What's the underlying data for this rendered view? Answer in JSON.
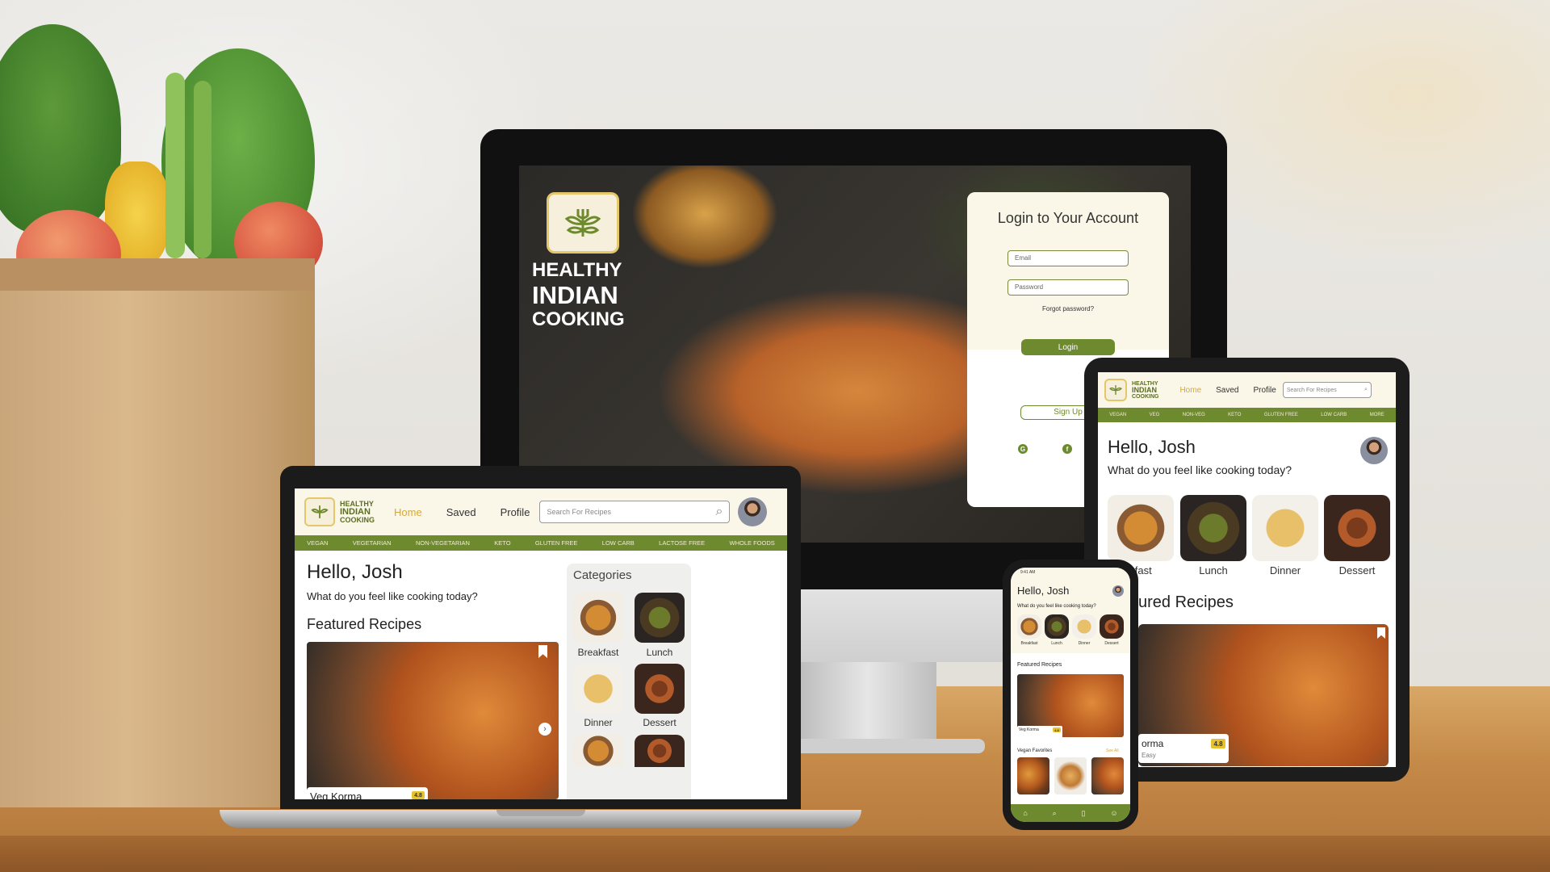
{
  "brand": {
    "line1": "HEALTHY",
    "line2": "INDIAN",
    "line3": "COOKING"
  },
  "login": {
    "title": "Login to Your Account",
    "email_placeholder": "Email",
    "password_placeholder": "Password",
    "forgot": "Forgot password?",
    "login_label": "Login",
    "no_account": "Don't have an a",
    "signup_label": "Sign Up",
    "continue": "Continue Without S",
    "social": [
      "google-icon",
      "facebook-icon"
    ]
  },
  "nav": {
    "home": "Home",
    "saved": "Saved",
    "profile": "Profile",
    "search_placeholder": "Search For Recipes"
  },
  "laptop": {
    "categories_bar": [
      "VEGAN",
      "VEGETARIAN",
      "NON-VEGETARIAN",
      "KETO",
      "GLUTEN FREE",
      "LOW CARB",
      "LACTOSE FREE",
      "WHOLE FOODS"
    ],
    "hello": "Hello, Josh",
    "question": "What do you feel like cooking today?",
    "featured_title": "Featured Recipes",
    "featured_recipe": {
      "name": "Veg Korma",
      "rating": "4.8"
    },
    "categories_title": "Categories",
    "categories": [
      "Breakfast",
      "Lunch",
      "Dinner",
      "Dessert"
    ]
  },
  "tablet": {
    "categories_bar": [
      "VEGAN",
      "VEG",
      "NON-VEG",
      "KETO",
      "GLUTEN FREE",
      "LOW CARB",
      "MORE"
    ],
    "hello": "Hello, Josh",
    "question": "What do you feel like cooking today?",
    "categories": [
      "kfast",
      "Lunch",
      "Dinner",
      "Dessert"
    ],
    "featured_title": "ured Recipes",
    "featured_recipe": {
      "name": "orma",
      "difficulty": "Easy",
      "rating": "4.8"
    }
  },
  "phone": {
    "status_time": "9:41 AM",
    "hello": "Hello, Josh",
    "question": "What do you feel like cooking today?",
    "categories": [
      "Breakfast",
      "Lunch",
      "Dinner",
      "Dessert"
    ],
    "featured_title": "Featured Recipes",
    "featured_recipe": {
      "name": "Veg Korma",
      "rating": "4.8"
    },
    "vegan_title": "Vegan Favorites",
    "see_all": "See All",
    "tabbar": [
      "home-icon",
      "search-icon",
      "bookmark-icon",
      "profile-icon"
    ]
  },
  "colors": {
    "green": "#6e8a2e",
    "cream": "#faf6e8",
    "gold": "#e3c76a",
    "home_active": "#d6a93a"
  }
}
